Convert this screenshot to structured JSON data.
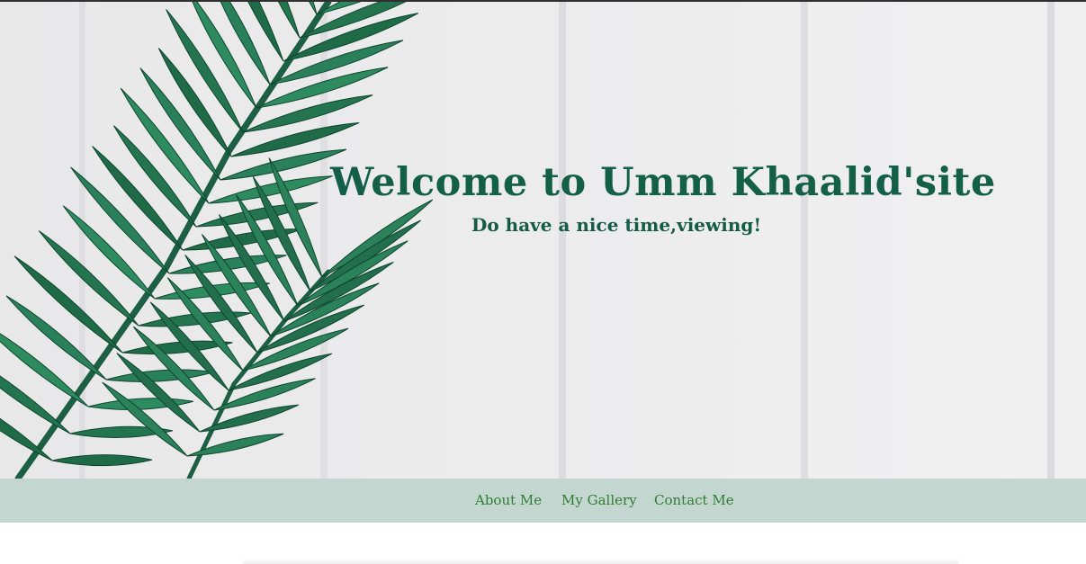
{
  "hero": {
    "title": "Welcome to Umm Khaalid'site",
    "subtitle": "Do have a nice time,viewing!",
    "background_icon": "palm-leaf-on-white-wood",
    "title_color": "#136047"
  },
  "nav": {
    "background_color": "#c4d6d0",
    "link_color": "#2f7d32",
    "items": [
      {
        "label": "About Me"
      },
      {
        "label": "My Gallery"
      },
      {
        "label": "Contact Me"
      }
    ]
  }
}
